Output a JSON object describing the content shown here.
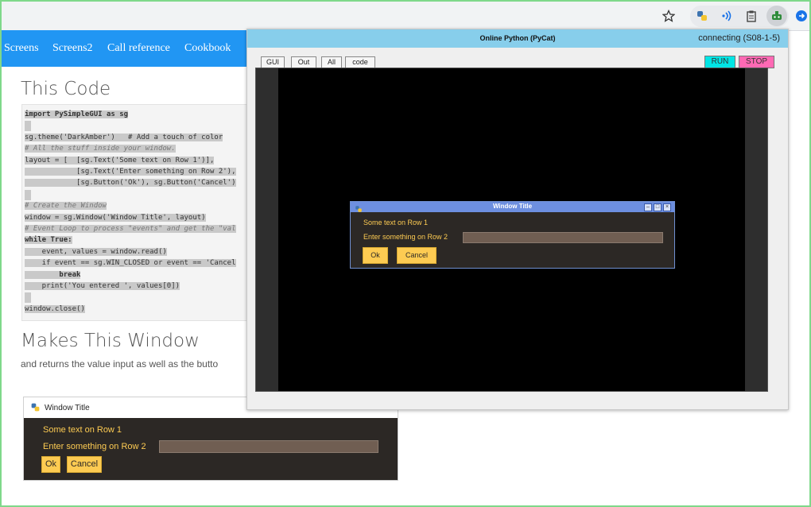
{
  "browser": {
    "star_icon": "star-icon",
    "extensions": [
      "python-icon",
      "cast-icon",
      "clipboard-icon",
      "robot-icon",
      "arrow-icon"
    ]
  },
  "nav": {
    "items": [
      "Screens",
      "Screens2",
      "Call reference",
      "Cookbook"
    ]
  },
  "page": {
    "heading1": "This Code",
    "heading2": "Makes This Window",
    "paragraph": "and returns the value input as well as the butto",
    "code_lines": [
      {
        "text": "import PySimpleGUI as sg",
        "kind": "kw"
      },
      {
        "text": "",
        "kind": "blank"
      },
      {
        "text": "sg.theme('DarkAmber')   # Add a touch of color",
        "kind": "mix"
      },
      {
        "text": "# All the stuff inside your window.",
        "kind": "cm"
      },
      {
        "text": "layout = [  [sg.Text('Some text on Row 1')],",
        "kind": "code"
      },
      {
        "text": "            [sg.Text('Enter something on Row 2'),",
        "kind": "code"
      },
      {
        "text": "            [sg.Button('Ok'), sg.Button('Cancel')",
        "kind": "code"
      },
      {
        "text": "",
        "kind": "blank"
      },
      {
        "text": "# Create the Window",
        "kind": "cm"
      },
      {
        "text": "window = sg.Window('Window Title', layout)",
        "kind": "code"
      },
      {
        "text": "# Event Loop to process \"events\" and get the \"val",
        "kind": "cm"
      },
      {
        "text": "while True:",
        "kind": "kw"
      },
      {
        "text": "    event, values = window.read()",
        "kind": "code"
      },
      {
        "text": "    if event == sg.WIN_CLOSED or event == 'Cancel",
        "kind": "code"
      },
      {
        "text": "        break",
        "kind": "kw"
      },
      {
        "text": "    print('You entered ', values[0])",
        "kind": "code"
      },
      {
        "text": "",
        "kind": "blank"
      },
      {
        "text": "window.close()",
        "kind": "code"
      }
    ]
  },
  "sample_window": {
    "title": "Window Title",
    "row1": "Some text on Row 1",
    "row2_label": "Enter something on Row 2",
    "ok": "Ok",
    "cancel": "Cancel"
  },
  "pycat": {
    "title": "Online Python (PyCat)",
    "status": "connecting (S08-1-5)",
    "tabs": [
      "GUI",
      "Out",
      "All",
      "code"
    ],
    "run": "RUN",
    "stop": "STOP",
    "inner": {
      "title": "Window Title",
      "row1": "Some text on Row 1",
      "row2_label": "Enter something on Row 2",
      "ok": "Ok",
      "cancel": "Cancel"
    }
  },
  "colors": {
    "nav": "#2196f3",
    "amber": "#fdcb52",
    "dark_bg": "#2c2825",
    "pycat_title": "#87ceeb",
    "run": "#00e5e5",
    "stop": "#ff69b4"
  }
}
